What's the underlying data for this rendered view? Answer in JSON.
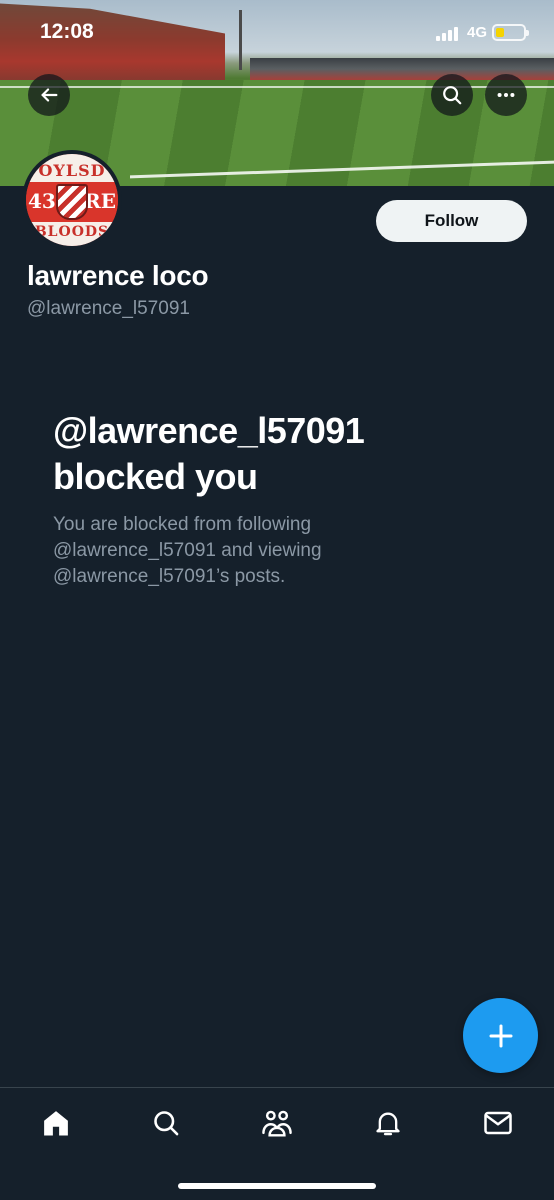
{
  "status_bar": {
    "time": "12:08",
    "network": "4G",
    "battery_level": 0.3,
    "battery_color": "#f5d300"
  },
  "banner": {
    "back_icon": "arrow-left-icon",
    "search_icon": "search-icon",
    "more_icon": "more-horizontal-icon"
  },
  "avatar": {
    "crest_top_text": "OYLSD",
    "crest_left_text": "43",
    "crest_right_text": "RE",
    "crest_bottom_text": "BLOODS"
  },
  "profile": {
    "display_name": "lawrence loco",
    "handle": "@lawrence_l57091",
    "follow_label": "Follow"
  },
  "blocked": {
    "title_line1": "@lawrence_l57091",
    "title_line2": "blocked you",
    "description": "You are blocked from following @lawrence_l57091 and viewing @lawrence_l57091’s posts."
  },
  "fab": {
    "icon": "plus-icon"
  },
  "bottom_nav": {
    "items": [
      {
        "icon": "home-icon",
        "active": true
      },
      {
        "icon": "search-icon",
        "active": false
      },
      {
        "icon": "communities-icon",
        "active": false
      },
      {
        "icon": "bell-icon",
        "active": false
      },
      {
        "icon": "mail-icon",
        "active": false
      }
    ]
  },
  "colors": {
    "background": "#15202b",
    "accent": "#1d9bf0",
    "secondary_text": "#8b98a5",
    "follow_button": "#eff3f4"
  }
}
